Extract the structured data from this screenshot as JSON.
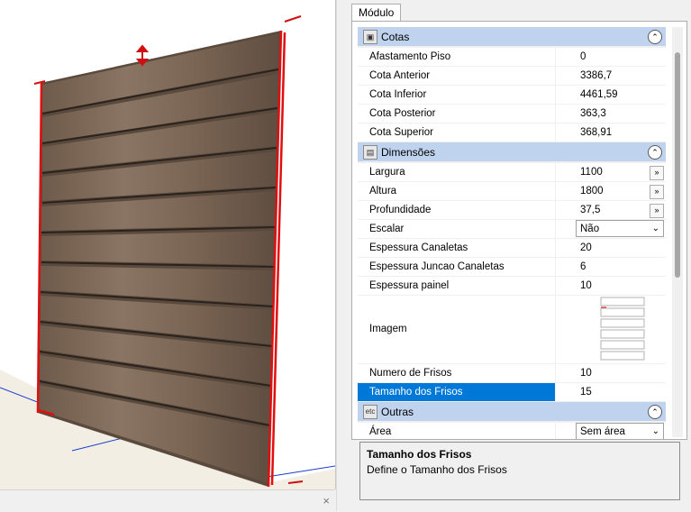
{
  "panel": {
    "tab_label": "Módulo",
    "categories": [
      {
        "name": "Cotas",
        "icon": "dimension-icon",
        "rows": [
          {
            "label": "Afastamento Piso",
            "value": "0"
          },
          {
            "label": "Cota Anterior",
            "value": "3386,7"
          },
          {
            "label": "Cota Inferior",
            "value": "4461,59"
          },
          {
            "label": "Cota Posterior",
            "value": "363,3"
          },
          {
            "label": "Cota Superior",
            "value": "368,91"
          }
        ]
      },
      {
        "name": "Dimensões",
        "icon": "ruler-icon",
        "rows": [
          {
            "label": "Largura",
            "value": "1100"
          },
          {
            "label": "Altura",
            "value": "1800"
          },
          {
            "label": "Profundidade",
            "value": "37,5"
          },
          {
            "label": "Escalar",
            "value": "Não"
          },
          {
            "label": "Espessura Canaletas",
            "value": "20"
          },
          {
            "label": "Espessura Juncao Canaletas",
            "value": "6"
          },
          {
            "label": "Espessura painel",
            "value": "10"
          },
          {
            "label": "Imagem",
            "value": ""
          },
          {
            "label": "Numero de Frisos",
            "value": "10"
          },
          {
            "label": "Tamanho dos Frisos",
            "value": "15"
          }
        ]
      },
      {
        "name": "Outras",
        "icon_text": "etc",
        "rows": [
          {
            "label": "Área",
            "value": "Sem área"
          }
        ]
      }
    ],
    "help_title": "Tamanho dos Frisos",
    "help_description": "Define o Tamanho dos Frisos",
    "ellipsis": "»",
    "collapse_glyph": "⌃",
    "dropdown_glyph": "⌄"
  },
  "viewport": {
    "close_glyph": "×"
  },
  "colors": {
    "selection": "#0078d7",
    "category_header": "#bfd3ee",
    "edge_highlight": "#e01010",
    "wood": "#7a6452"
  }
}
